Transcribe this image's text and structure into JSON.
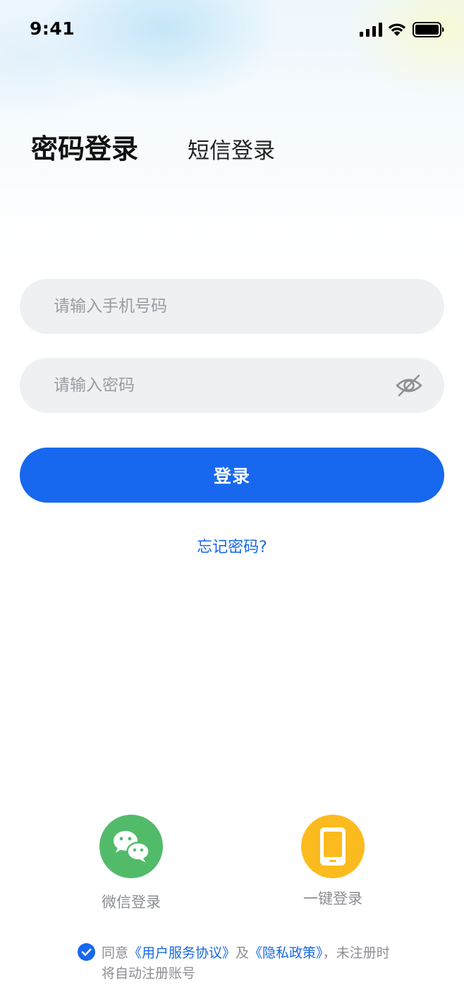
{
  "status_bar": {
    "time": "9:41",
    "icons": [
      "signal-icon",
      "wifi-icon",
      "battery-icon"
    ]
  },
  "tabs": {
    "password_login": "密码登录",
    "sms_login": "短信登录",
    "active": "password_login"
  },
  "form": {
    "phone_placeholder": "请输入手机号码",
    "phone_value": "",
    "password_placeholder": "请输入密码",
    "password_value": "",
    "password_visibility_icon": "eye-off-icon"
  },
  "login_button": "登录",
  "forgot_password": "忘记密码?",
  "social_login": {
    "wechat": {
      "label": "微信登录",
      "icon": "wechat-icon",
      "color": "#52bb6a"
    },
    "one_click": {
      "label": "一键登录",
      "icon": "phone-icon",
      "color": "#fbbb1e"
    }
  },
  "agreement": {
    "checked": true,
    "prefix": "同意",
    "terms_link": "《用户服务协议》",
    "middle": "及",
    "privacy_link": "《隐私政策》",
    "suffix": "，未注册时将自动注册账号"
  },
  "colors": {
    "primary": "#1768ee",
    "link": "#1668e6",
    "field_bg": "#eff0f2",
    "muted_text": "#8c8e93"
  }
}
